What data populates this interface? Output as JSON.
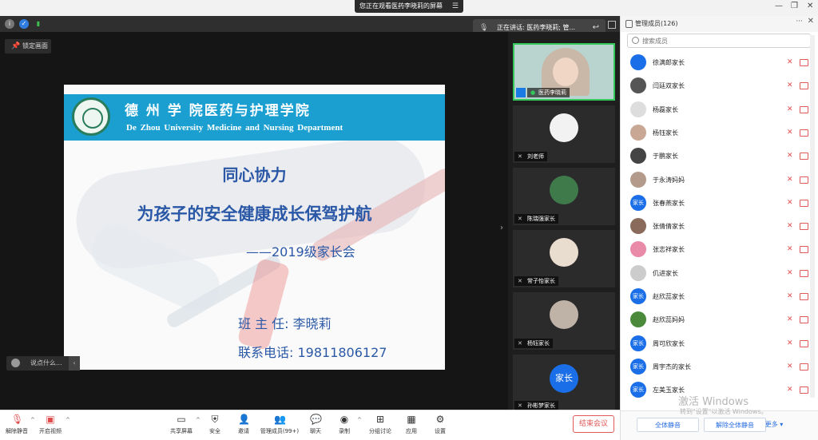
{
  "title_bar": {
    "share_notice": "您正在观看医药李晓莉的屏幕",
    "minimize": "—",
    "restore": "❐",
    "close": "✕"
  },
  "speaking": {
    "label": "正在讲话: 医药李晓莉; 管..."
  },
  "stage": {
    "lock_screen": "锁定画面",
    "chat_placeholder": "说点什么..."
  },
  "slide": {
    "university_cn": "德 州 学 院医药与护理学院",
    "university_en": "De Zhou University    Medicine and Nursing Department",
    "headline1": "同心协力",
    "headline2": "为孩子的安全健康成长保驾护航",
    "subline": "——2019级家长会",
    "teacher": "班 主 任: 李晓莉",
    "phone": "联系电话: 19811806127"
  },
  "tiles": [
    {
      "name": "医药李晓莉",
      "type": "portrait"
    },
    {
      "name": "刘老师",
      "type": "avatar",
      "color": "#f2f2f2"
    },
    {
      "name": "陈瑞强家长",
      "type": "avatar",
      "color": "#3f7a4a"
    },
    {
      "name": "常子怡家长",
      "type": "avatar",
      "color": "#e9ddd0"
    },
    {
      "name": "杨钰家长",
      "type": "avatar",
      "color": "#bfb3a8"
    },
    {
      "name": "孙彬梦家长",
      "type": "avatar-text",
      "text": "家长"
    }
  ],
  "panel": {
    "title": "管理成员(126)",
    "more": "···",
    "close": "✕",
    "search_placeholder": "搜索成员",
    "members": [
      {
        "name": "徐满郎家长",
        "color": "#1a6fe8",
        "text": ""
      },
      {
        "name": "闫廷双家长",
        "color": "#555555",
        "text": ""
      },
      {
        "name": "杨磊家长",
        "color": "#dddddd",
        "text": ""
      },
      {
        "name": "杨钰家长",
        "color": "#c8a894",
        "text": ""
      },
      {
        "name": "于鹏家长",
        "color": "#444444",
        "text": ""
      },
      {
        "name": "于永涛妈妈",
        "color": "#b49a8a",
        "text": ""
      },
      {
        "name": "张春燕家长",
        "color": "#1a6fe8",
        "text": "家长"
      },
      {
        "name": "张倩倩家长",
        "color": "#8a6a5a",
        "text": ""
      },
      {
        "name": "张志祥家长",
        "color": "#e88aa8",
        "text": ""
      },
      {
        "name": "仉进家长",
        "color": "#cccccc",
        "text": ""
      },
      {
        "name": "赵欣蕊家长",
        "color": "#1a6fe8",
        "text": "家长"
      },
      {
        "name": "赵欣蕊妈妈",
        "color": "#4a8a3a",
        "text": ""
      },
      {
        "name": "周可欣家长",
        "color": "#1a6fe8",
        "text": "家长"
      },
      {
        "name": "周宇杰的家长",
        "color": "#1a6fe8",
        "text": "家长"
      },
      {
        "name": "左美玉家长",
        "color": "#1a6fe8",
        "text": "家长"
      }
    ],
    "mute_all": "全体静音",
    "unmute_all": "解除全体静音",
    "more_btn": "更多 ▾"
  },
  "watermark": {
    "line1": "激活 Windows",
    "line2": "转到\"设置\"以激活 Windows。"
  },
  "toolbar": {
    "unmute": "解除静音",
    "video": "开启视频",
    "share": "共享屏幕",
    "security": "安全",
    "invite": "邀请",
    "members": "管理成员(99+)",
    "chat": "聊天",
    "record": "录制",
    "breakout": "分组讨论",
    "apps": "应用",
    "settings": "设置",
    "end": "结束会议"
  }
}
